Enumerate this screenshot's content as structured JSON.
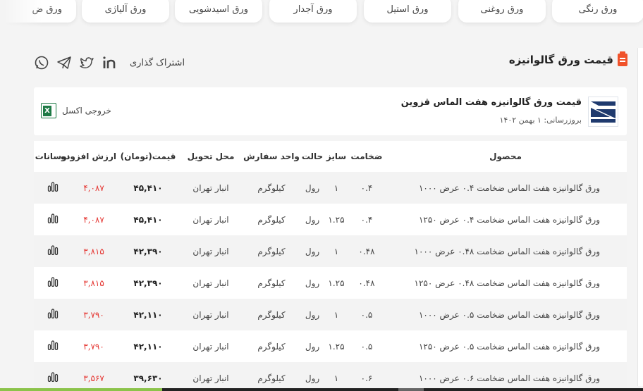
{
  "categories": [
    {
      "label": "ورق رنگی"
    },
    {
      "label": "ورق روغنی"
    },
    {
      "label": "ورق استیل"
    },
    {
      "label": "ورق آجدار"
    },
    {
      "label": "ورق اسیدشویی"
    },
    {
      "label": "ورق آلیاژی"
    },
    {
      "label": "ورق ض"
    }
  ],
  "heading": {
    "title": "قیمت ورق گالوانیزه"
  },
  "share": {
    "label": "اشتراک گذاری"
  },
  "card": {
    "title": "قیمت ورق گالوانیزه هفت الماس قزوین",
    "date": "بروزرسانی: ۱ بهمن ۱۴۰۲",
    "excel_label": "خروجی اکسل"
  },
  "table": {
    "headers": {
      "product": "محصول",
      "thickness": "ضخامت",
      "size": "سایز",
      "state": "حالت",
      "unit": "واحد سفارش",
      "delivery": "محل تحویل",
      "price": "قیمت(تومان)",
      "vat": "ارزش افزوده",
      "fluct": "نوسانات"
    },
    "rows": [
      {
        "product": "ورق گالوانیزه هفت الماس ضخامت ۰.۴ عرض ۱۰۰۰",
        "thickness": "۰.۴",
        "size": "۱",
        "state": "رول",
        "unit": "کیلوگرم",
        "delivery": "انبار تهران",
        "price": "۴۵,۴۱۰",
        "vat": "۴,۰۸۷"
      },
      {
        "product": "ورق گالوانیزه هفت الماس ضخامت ۰.۴ عرض ۱۲۵۰",
        "thickness": "۰.۴",
        "size": "۱.۲۵",
        "state": "رول",
        "unit": "کیلوگرم",
        "delivery": "انبار تهران",
        "price": "۴۵,۴۱۰",
        "vat": "۴,۰۸۷"
      },
      {
        "product": "ورق گالوانیزه هفت الماس ضخامت ۰.۴۸ عرض ۱۰۰۰",
        "thickness": "۰.۴۸",
        "size": "۱",
        "state": "رول",
        "unit": "کیلوگرم",
        "delivery": "انبار تهران",
        "price": "۴۲,۳۹۰",
        "vat": "۳,۸۱۵"
      },
      {
        "product": "ورق گالوانیزه هفت الماس ضخامت ۰.۴۸ عرض ۱۲۵۰",
        "thickness": "۰.۴۸",
        "size": "۱.۲۵",
        "state": "رول",
        "unit": "کیلوگرم",
        "delivery": "انبار تهران",
        "price": "۴۲,۳۹۰",
        "vat": "۳,۸۱۵"
      },
      {
        "product": "ورق گالوانیزه هفت الماس ضخامت ۰.۵ عرض ۱۰۰۰",
        "thickness": "۰.۵",
        "size": "۱",
        "state": "رول",
        "unit": "کیلوگرم",
        "delivery": "انبار تهران",
        "price": "۴۲,۱۱۰",
        "vat": "۳,۷۹۰"
      },
      {
        "product": "ورق گالوانیزه هفت الماس ضخامت ۰.۵ عرض ۱۲۵۰",
        "thickness": "۰.۵",
        "size": "۱.۲۵",
        "state": "رول",
        "unit": "کیلوگرم",
        "delivery": "انبار تهران",
        "price": "۴۲,۱۱۰",
        "vat": "۳,۷۹۰"
      },
      {
        "product": "ورق گالوانیزه هفت الماس ضخامت ۰.۶ عرض ۱۰۰۰",
        "thickness": "۰.۶",
        "size": "۱",
        "state": "رول",
        "unit": "کیلوگرم",
        "delivery": "انبار تهران",
        "price": "۳۹,۶۳۰",
        "vat": "۳,۵۶۷"
      }
    ]
  },
  "colors": {
    "accent": "#f0522a",
    "vat": "#e53935",
    "excel": "#1d7a45",
    "logo": "#1f3a6e"
  }
}
